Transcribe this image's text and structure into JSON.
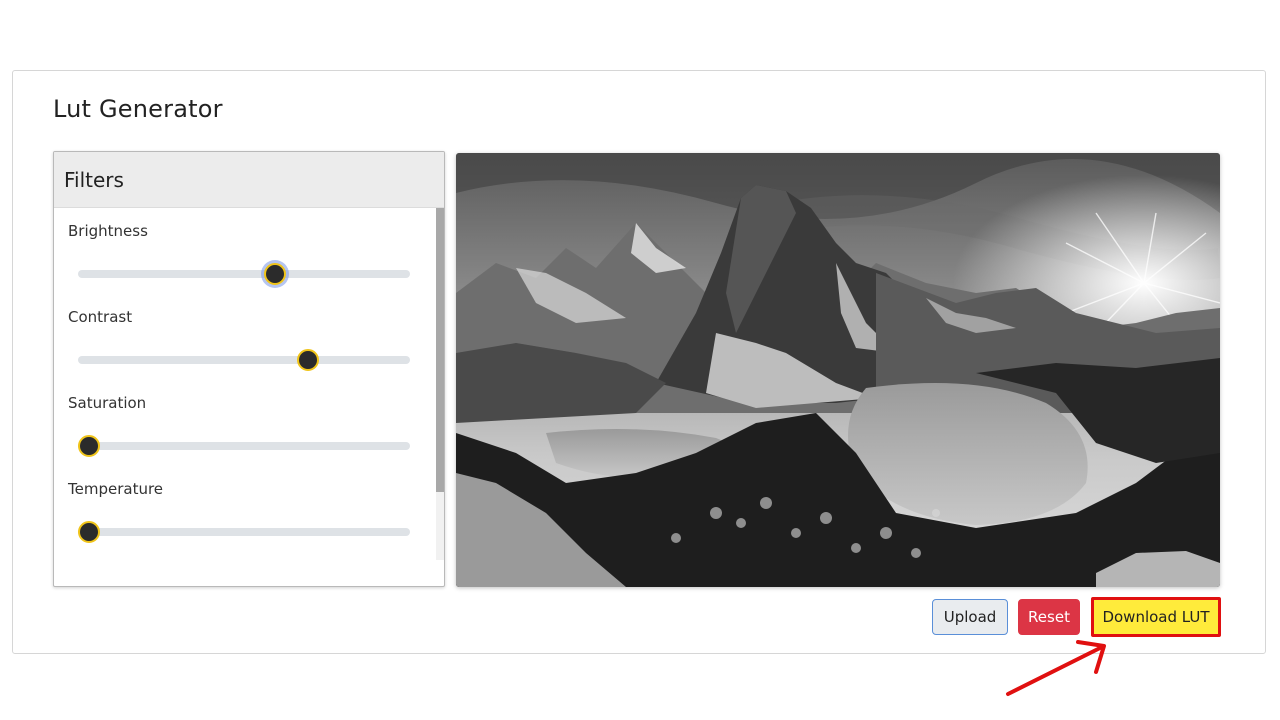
{
  "app": {
    "title": "Lut Generator"
  },
  "filters": {
    "header": "Filters",
    "items": [
      {
        "label": "Brightness",
        "value": 0.59,
        "focused": true
      },
      {
        "label": "Contrast",
        "value": 0.69,
        "focused": false
      },
      {
        "label": "Saturation",
        "value": 0.0,
        "focused": false
      },
      {
        "label": "Temperature",
        "value": 0.0,
        "focused": false
      }
    ]
  },
  "preview": {
    "image_description_icon": "landscape-photo",
    "mode": "grayscale"
  },
  "actions": {
    "upload_label": "Upload",
    "reset_label": "Reset",
    "download_label": "Download LUT"
  },
  "colors": {
    "reset": "#dc3545",
    "download_bg": "#ffeb3b",
    "highlight_border": "#e01010",
    "slider_thumb": "#2b2b2b",
    "slider_thumb_ring": "#f0c419"
  },
  "annotation": {
    "icon": "red-arrow-icon"
  }
}
